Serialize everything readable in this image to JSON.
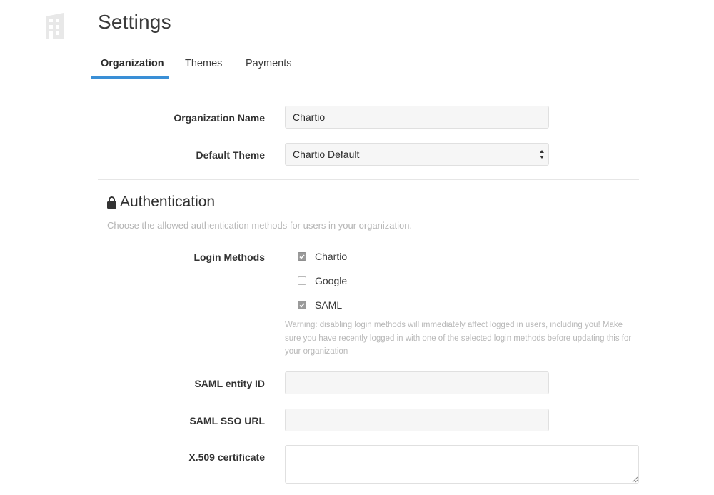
{
  "header": {
    "title": "Settings",
    "logo_icon": "building-icon"
  },
  "tabs": [
    {
      "label": "Organization",
      "active": true
    },
    {
      "label": "Themes",
      "active": false
    },
    {
      "label": "Payments",
      "active": false
    }
  ],
  "colors": {
    "accent": "#3a8fd6",
    "input_bg": "#f6f6f6",
    "muted_text": "#b5b5b5",
    "checkbox_checked": "#9a9a9a"
  },
  "organization": {
    "name_label": "Organization Name",
    "name_value": "Chartio",
    "theme_label": "Default Theme",
    "theme_value": "Chartio Default"
  },
  "authentication": {
    "title": "Authentication",
    "icon": "lock-icon",
    "description": "Choose the allowed authentication methods for users in your organization.",
    "login_methods_label": "Login Methods",
    "methods": [
      {
        "label": "Chartio",
        "checked": true
      },
      {
        "label": "Google",
        "checked": false
      },
      {
        "label": "SAML",
        "checked": true
      }
    ],
    "warning": "Warning: disabling login methods will immediately affect logged in users, including you! Make sure you have recently logged in with one of the selected login methods before updating this for your organization",
    "saml_entity_label": "SAML entity ID",
    "saml_entity_value": "",
    "saml_sso_label": "SAML SSO URL",
    "saml_sso_value": "",
    "x509_label": "X.509 certificate",
    "x509_value": ""
  }
}
